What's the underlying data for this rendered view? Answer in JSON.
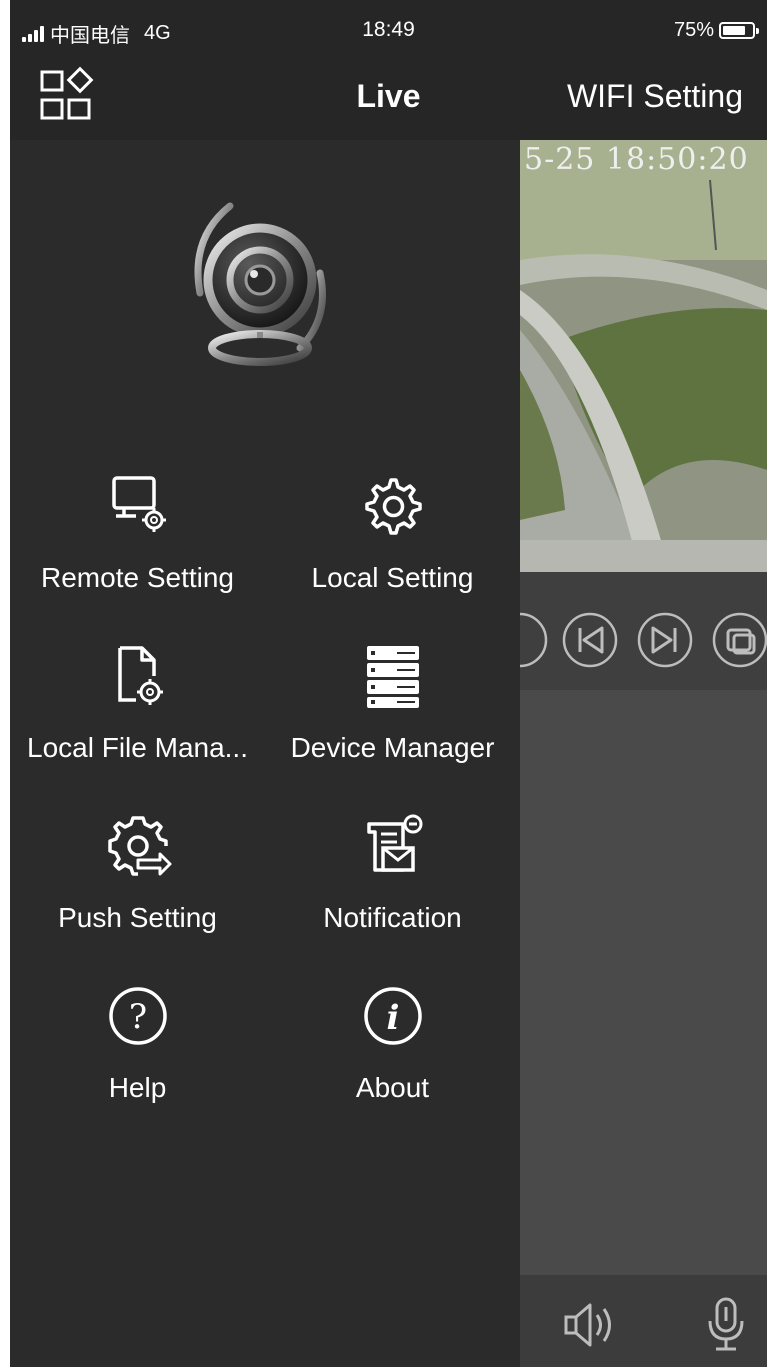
{
  "status_bar": {
    "carrier": "中国电信",
    "network": "4G",
    "time": "18:49",
    "battery_level": "75%"
  },
  "header": {
    "title": "Live",
    "wifi_setting_label": "WIFI Setting"
  },
  "video": {
    "timestamp": "5-25 18:50:20"
  },
  "menu": {
    "items": [
      {
        "label": "Remote Setting",
        "icon": "remote-setting-icon"
      },
      {
        "label": "Local Setting",
        "icon": "gear-icon"
      },
      {
        "label": "Local File Mana...",
        "icon": "file-settings-icon"
      },
      {
        "label": "Device Manager",
        "icon": "server-rack-icon"
      },
      {
        "label": "Push Setting",
        "icon": "push-setting-icon"
      },
      {
        "label": "Notification",
        "icon": "notification-icon"
      },
      {
        "label": "Help",
        "icon": "help-icon"
      },
      {
        "label": "About",
        "icon": "info-icon"
      }
    ]
  },
  "playback": {
    "buttons": [
      "record-icon",
      "previous-icon",
      "next-icon",
      "snapshot-icon"
    ]
  },
  "bottom_bar": {
    "buttons": [
      "speaker-icon",
      "microphone-icon"
    ]
  },
  "colors": {
    "menu_bg": "#2b2b2b",
    "header_bg": "#262626",
    "text": "#ffffff"
  }
}
